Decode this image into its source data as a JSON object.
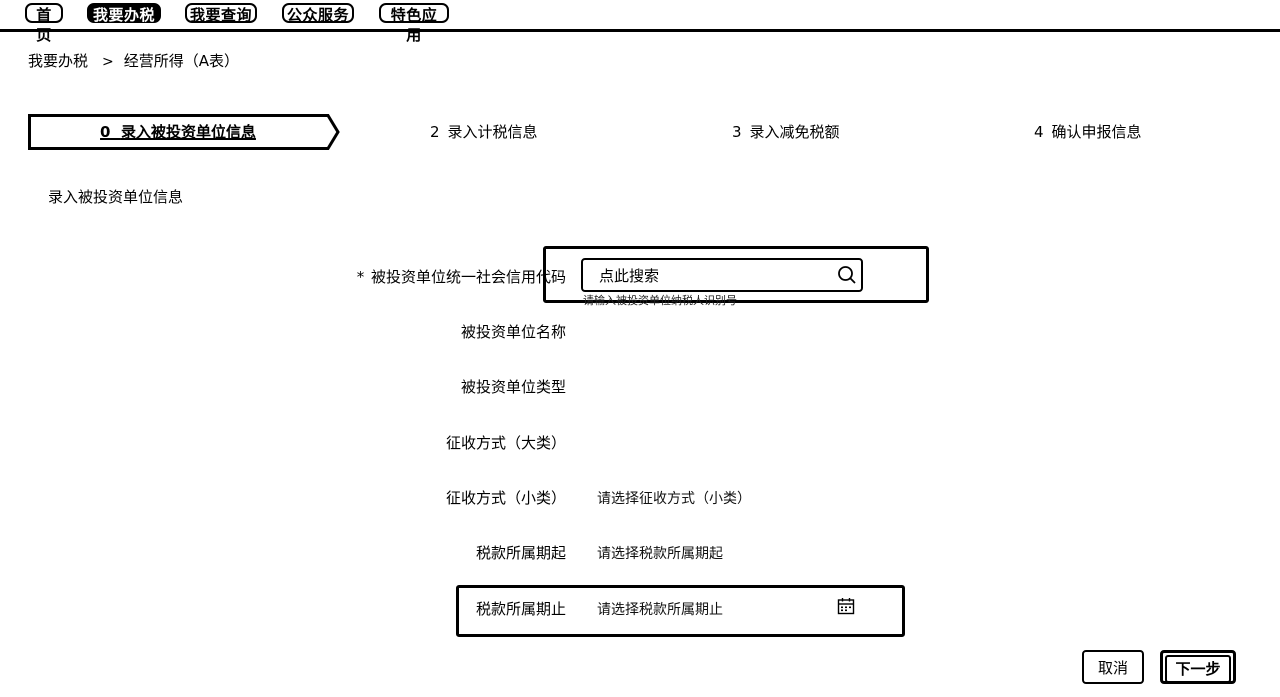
{
  "nav": {
    "items": [
      {
        "label": "首页"
      },
      {
        "label": "我要办税"
      },
      {
        "label": "我要查询"
      },
      {
        "label": "公众服务"
      },
      {
        "label": "特色应用"
      }
    ]
  },
  "breadcrumb": {
    "root": "我要办税",
    "separator": ">",
    "current": "经营所得（A表）"
  },
  "steps": [
    {
      "num": "0",
      "label": "录入被投资单位信息",
      "active": true
    },
    {
      "num": "2",
      "label": "录入计税信息"
    },
    {
      "num": "3",
      "label": "录入减免税额"
    },
    {
      "num": "4",
      "label": "确认申报信息"
    }
  ],
  "section_title": "录入被投资单位信息",
  "form": {
    "credit_code": {
      "required_mark": "*",
      "label": "被投资单位统一社会信用代码",
      "placeholder": "点此搜索",
      "hint": "请输入被投资单位纳税人识别号"
    },
    "unit_name": {
      "label": "被投资单位名称"
    },
    "unit_type": {
      "label": "被投资单位类型"
    },
    "collection_major": {
      "label": "征收方式（大类）"
    },
    "collection_minor": {
      "label": "征收方式（小类）",
      "placeholder": "请选择征收方式（小类）"
    },
    "period_start": {
      "label": "税款所属期起",
      "placeholder": "请选择税款所属期起"
    },
    "period_end": {
      "label": "税款所属期止",
      "placeholder": "请选择税款所属期止"
    }
  },
  "buttons": {
    "cancel": "取消",
    "next": "下一步"
  },
  "icons": {
    "search": "search-icon",
    "calendar": "calendar-icon"
  }
}
